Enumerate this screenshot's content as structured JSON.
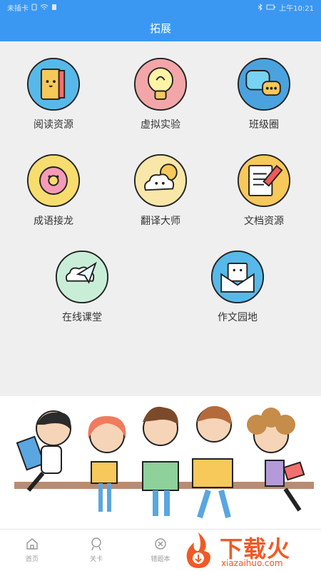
{
  "status": {
    "carrier": "未插卡",
    "time": "上午10:21"
  },
  "header": {
    "title": "拓展"
  },
  "tiles": [
    {
      "label": "阅读资源",
      "icon": "book-icon"
    },
    {
      "label": "虚拟实验",
      "icon": "lightbulb-icon"
    },
    {
      "label": "班级圈",
      "icon": "chat-bubbles-icon"
    },
    {
      "label": "成语接龙",
      "icon": "donut-icon"
    },
    {
      "label": "翻译大师",
      "icon": "cloud-moon-icon"
    },
    {
      "label": "文档资源",
      "icon": "notepad-pencil-icon"
    },
    {
      "label": "在线课堂",
      "icon": "paper-plane-icon"
    },
    {
      "label": "作文园地",
      "icon": "envelope-icon"
    }
  ],
  "tabbar": {
    "items": [
      {
        "label": "首页",
        "icon": "home-icon"
      },
      {
        "label": "关卡",
        "icon": "level-icon"
      },
      {
        "label": "错题本",
        "icon": "wrong-answer-icon"
      }
    ]
  },
  "watermark": {
    "brand": "下载火",
    "domain": "xiazaihuo.com"
  },
  "colors": {
    "primary": "#3b98f2",
    "background": "#efefef",
    "brand_orange": "#f15a24"
  }
}
